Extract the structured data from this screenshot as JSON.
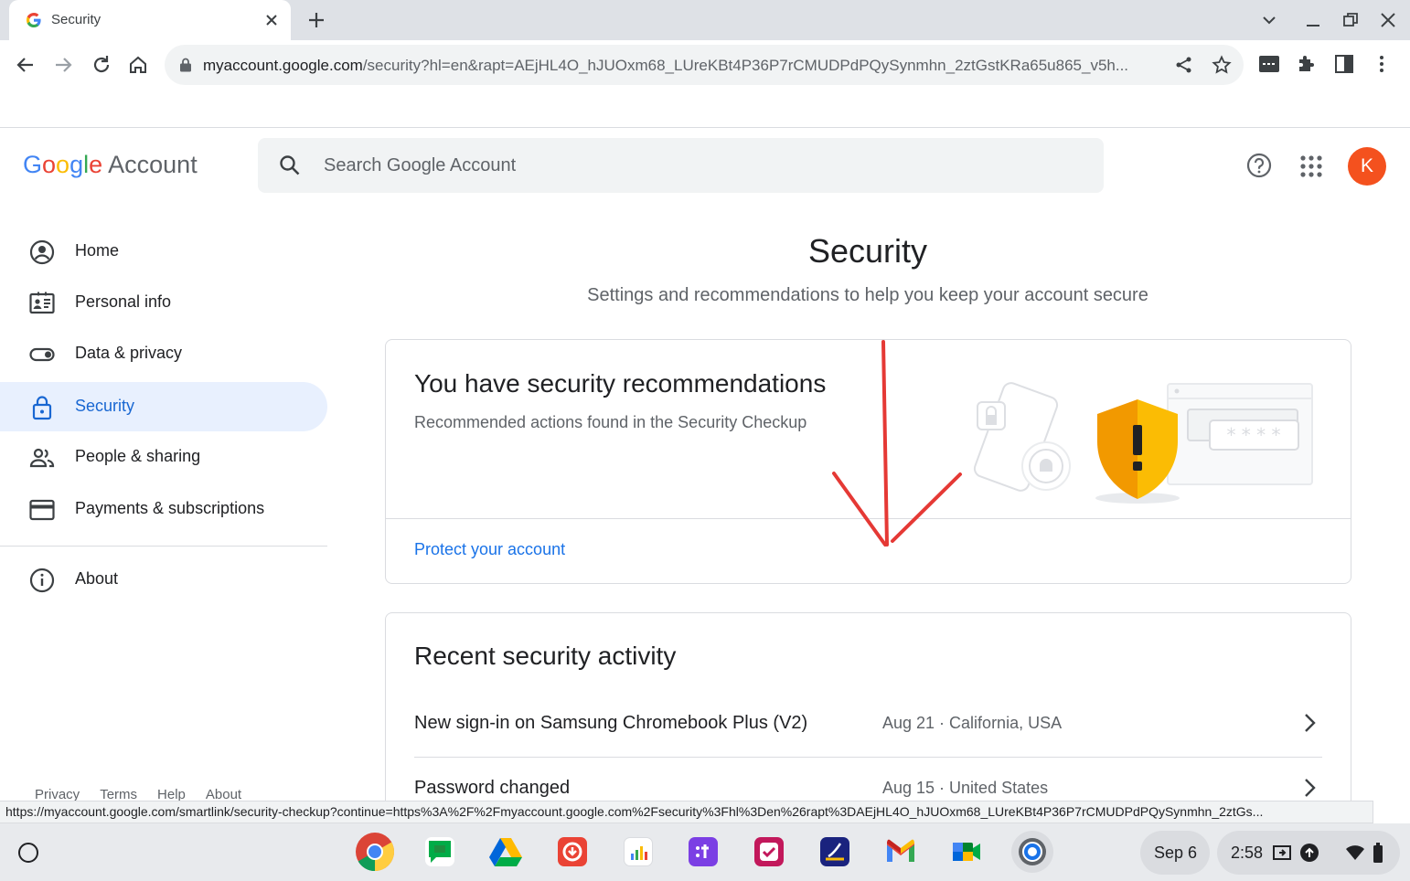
{
  "browser": {
    "tab_title": "Security",
    "url_host": "myaccount.google.com",
    "url_rest": "/security?hl=en&rapt=AEjHL4O_hJUOxm68_LUreKBt4P36P7rCMUDPdPQySynmhn_2ztGstKRa65u865_v5h...",
    "status_url": "https://myaccount.google.com/smartlink/security-checkup?continue=https%3A%2F%2Fmyaccount.google.com%2Fsecurity%3Fhl%3Den%26rapt%3DAEjHL4O_hJUOxm68_LUreKBt4P36P7rCMUDPdPQySynmhn_2ztGs..."
  },
  "header": {
    "logo_letters": [
      "G",
      "o",
      "o",
      "g",
      "l",
      "e"
    ],
    "logo_colors": [
      "#4285f4",
      "#ea4335",
      "#fbbc05",
      "#4285f4",
      "#34a853",
      "#ea4335"
    ],
    "logo_suffix": "Account",
    "search_placeholder": "Search Google Account",
    "avatar_letter": "K",
    "avatar_color": "#f4511e"
  },
  "sidebar": {
    "items": [
      {
        "label": "Home",
        "icon": "account-circle-icon"
      },
      {
        "label": "Personal info",
        "icon": "id-card-icon"
      },
      {
        "label": "Data & privacy",
        "icon": "toggle-icon"
      },
      {
        "label": "Security",
        "icon": "lock-icon",
        "active": true
      },
      {
        "label": "People & sharing",
        "icon": "people-icon"
      },
      {
        "label": "Payments & subscriptions",
        "icon": "credit-card-icon"
      }
    ],
    "about": {
      "label": "About",
      "icon": "info-icon"
    },
    "footer": [
      "Privacy",
      "Terms",
      "Help",
      "About"
    ]
  },
  "main": {
    "title": "Security",
    "subtitle": "Settings and recommendations to help you keep your account secure",
    "recommendations": {
      "title": "You have security recommendations",
      "description": "Recommended actions found in the Security Checkup",
      "link": "Protect your account"
    },
    "activity": {
      "title": "Recent security activity",
      "rows": [
        {
          "title": "New sign-in on Samsung Chromebook Plus (V2)",
          "meta": "Aug 21 · California, USA"
        },
        {
          "title": "Password changed",
          "meta": "Aug 15 · United States"
        }
      ]
    }
  },
  "shelf": {
    "apps": [
      "chrome",
      "google-chat",
      "google-drive",
      "red-app",
      "pay-app",
      "teams-app",
      "tasks-app",
      "lens-app",
      "gmail",
      "meet",
      "settings"
    ],
    "date": "Sep 6",
    "time": "2:58"
  }
}
